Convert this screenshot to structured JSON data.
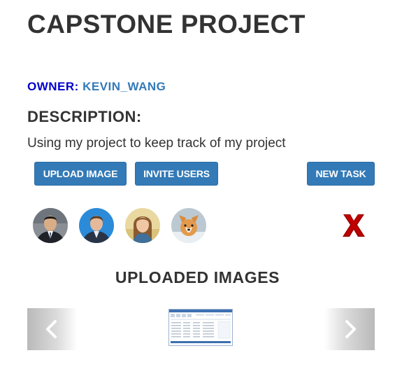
{
  "project": {
    "title": "CAPSTONE PROJECT",
    "owner_label": "OWNER:",
    "owner_name": "KEVIN_WANG",
    "description_heading": "DESCRIPTION:",
    "description_text": "Using my project to keep track of my project"
  },
  "actions": {
    "upload_label": "UPLOAD IMAGE",
    "invite_label": "INVITE USERS",
    "new_task_label": "NEW TASK"
  },
  "members": [
    {
      "icon": "user-avatar-1"
    },
    {
      "icon": "user-avatar-2"
    },
    {
      "icon": "user-avatar-3"
    },
    {
      "icon": "user-avatar-4"
    }
  ],
  "delete_icon": {
    "icon": "red-x-icon",
    "color": "#a00000"
  },
  "gallery": {
    "heading": "UPLOADED IMAGES",
    "prev_icon": "chevron-left-icon",
    "next_icon": "chevron-right-icon"
  },
  "colors": {
    "primary": "#337ab7",
    "owner_label": "#0000cc",
    "text": "#333333"
  }
}
